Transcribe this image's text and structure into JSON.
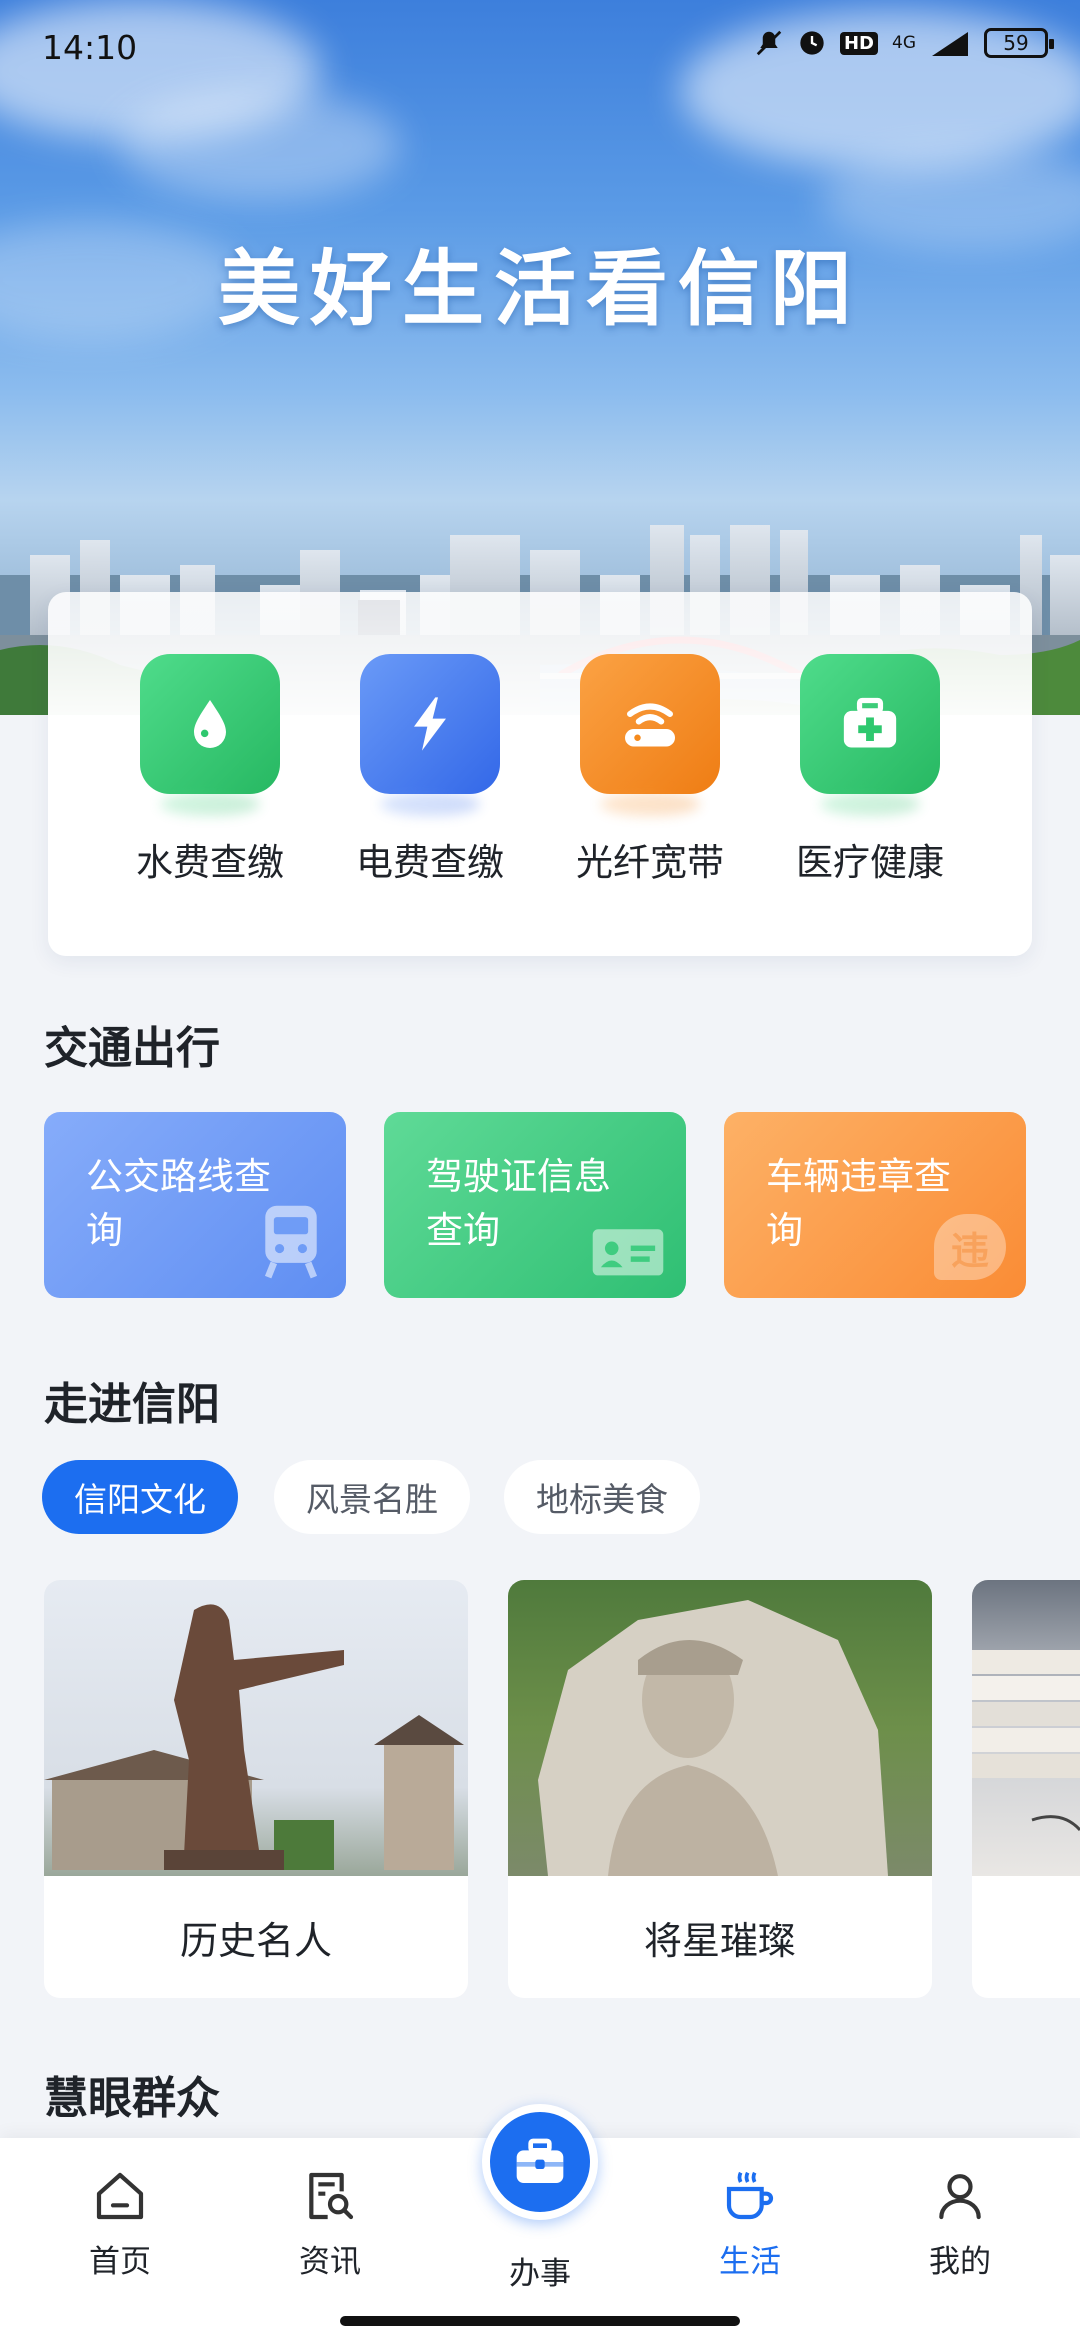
{
  "status_bar": {
    "time": "14:10",
    "network": "4G",
    "hd": "HD",
    "battery": "59"
  },
  "hero": {
    "title": "美好生活看信阳"
  },
  "services": [
    {
      "label": "水费查缴",
      "icon": "water-drop-icon",
      "color": "#2fc86f"
    },
    {
      "label": "电费查缴",
      "icon": "lightning-icon",
      "color": "#3d7af2"
    },
    {
      "label": "光纤宽带",
      "icon": "router-icon",
      "color": "#f58a1c"
    },
    {
      "label": "医疗健康",
      "icon": "medical-kit-icon",
      "color": "#2fc86f"
    }
  ],
  "traffic": {
    "title": "交通出行",
    "cards": [
      {
        "label": "公交路线查询",
        "icon": "bus-icon",
        "color": "#6f9cf6"
      },
      {
        "label": "驾驶证信息查询",
        "icon": "id-card-icon",
        "color": "#3fcc80"
      },
      {
        "label": "车辆违章查询",
        "icon": "violation-icon",
        "icon_text": "违",
        "color": "#fb9a45"
      }
    ]
  },
  "explore": {
    "title": "走进信阳",
    "tabs": [
      {
        "label": "信阳文化",
        "active": true
      },
      {
        "label": "风景名胜",
        "active": false
      },
      {
        "label": "地标美食",
        "active": false
      }
    ],
    "cards": [
      {
        "caption": "历史名人"
      },
      {
        "caption": "将星璀璨"
      },
      {
        "caption": ""
      }
    ]
  },
  "next_section": {
    "title": "慧眼群众"
  },
  "nav": {
    "items": [
      {
        "label": "首页",
        "icon": "home-icon",
        "active": false
      },
      {
        "label": "资讯",
        "icon": "news-search-icon",
        "active": false
      },
      {
        "label": "办事",
        "icon": "briefcase-icon",
        "active": false
      },
      {
        "label": "生活",
        "icon": "coffee-cup-icon",
        "active": true
      },
      {
        "label": "我的",
        "icon": "person-icon",
        "active": false
      }
    ]
  },
  "colors": {
    "accent": "#1c6ef0",
    "background": "#f2f4f8"
  }
}
